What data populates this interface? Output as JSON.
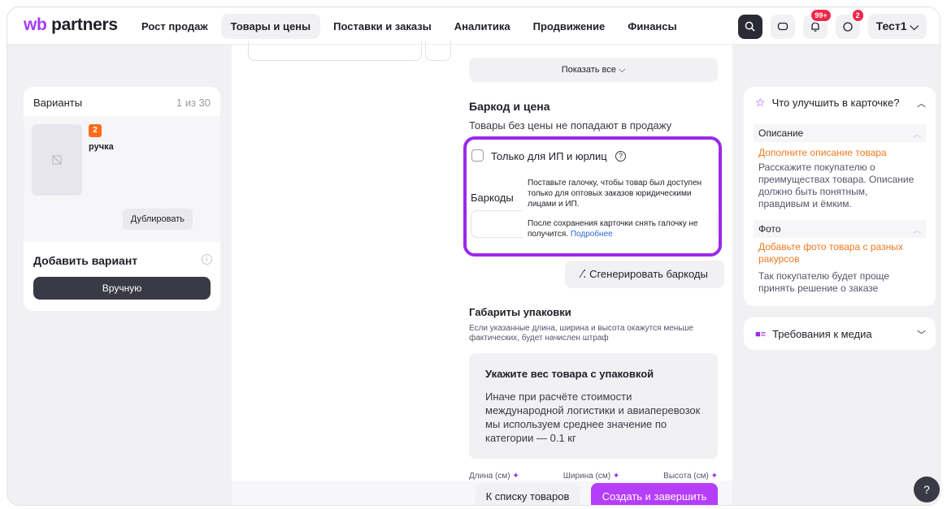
{
  "header": {
    "logo_prefix": "wb",
    "logo_suffix": " partners",
    "nav": [
      "Рост продаж",
      "Товары и цены",
      "Поставки и заказы",
      "Аналитика",
      "Продвижение",
      "Финансы"
    ],
    "notifications_badge": "99+",
    "messages_badge": "2",
    "user": "Тест1",
    "icons": [
      "search-icon",
      "chat-icon",
      "bell-icon",
      "messages-icon",
      "chevron-down-icon"
    ]
  },
  "variants": {
    "title": "Варианты",
    "count": "1 из 30",
    "item_badge": "2",
    "item_name": "ручка",
    "duplicate_label": "Дублировать",
    "add_title": "Добавить вариант",
    "manual_label": "Вручную"
  },
  "main": {
    "show_all": "Показать все",
    "barcode_title": "Баркод и цена",
    "barcode_subtitle": "Товары без цены не попадают в продажу",
    "checkbox_label": "Только для ИП и юрлиц",
    "barcodes_label": "Баркоды",
    "tooltip_p1": "Поставьте галочку, чтобы товар был доступен только для оптовых заказов юридическими лицами и ИП.",
    "tooltip_p2": "После сохранения карточки снять галочку не получится.",
    "tooltip_more": "Подробнее",
    "generate_label": "Сгенерировать баркоды",
    "dims_title": "Габариты упаковки",
    "dims_subtitle": "Если указанные длина, ширина и высота окажутся меньше фактических, будет начислен штраф",
    "weight_title": "Укажите вес товара с упаковкой",
    "weight_text": "Иначе при расчёте стоимости международной логистики и авиаперевозок мы используем среднее значение по категории — 0.1 кг",
    "length_label": "Длина (см)",
    "width_label": "Ширина (см)",
    "height_label": "Высота (см)",
    "back_label": "К списку товаров",
    "create_label": "Создать и завершить"
  },
  "improve": {
    "title": "Что улучшить в карточке?",
    "section_desc": "Описание",
    "desc_link": "Дополните описание товара",
    "desc_text": "Расскажите покупателю о преимуществах товара. Описание должно быть понятным, правдивым и ёмким.",
    "section_photo": "Фото",
    "photo_link": "Добавьте фото товара с разных ракурсов",
    "photo_text": "Так покупателю будет проще принять решение о заказе"
  },
  "media": {
    "title": "Требования к медиа"
  },
  "help_label": "?",
  "colors": {
    "accent": "#9b29e8",
    "primary_button": "#b53dfc",
    "link_orange": "#ef7a1d",
    "badge_red": "#f0284a"
  }
}
